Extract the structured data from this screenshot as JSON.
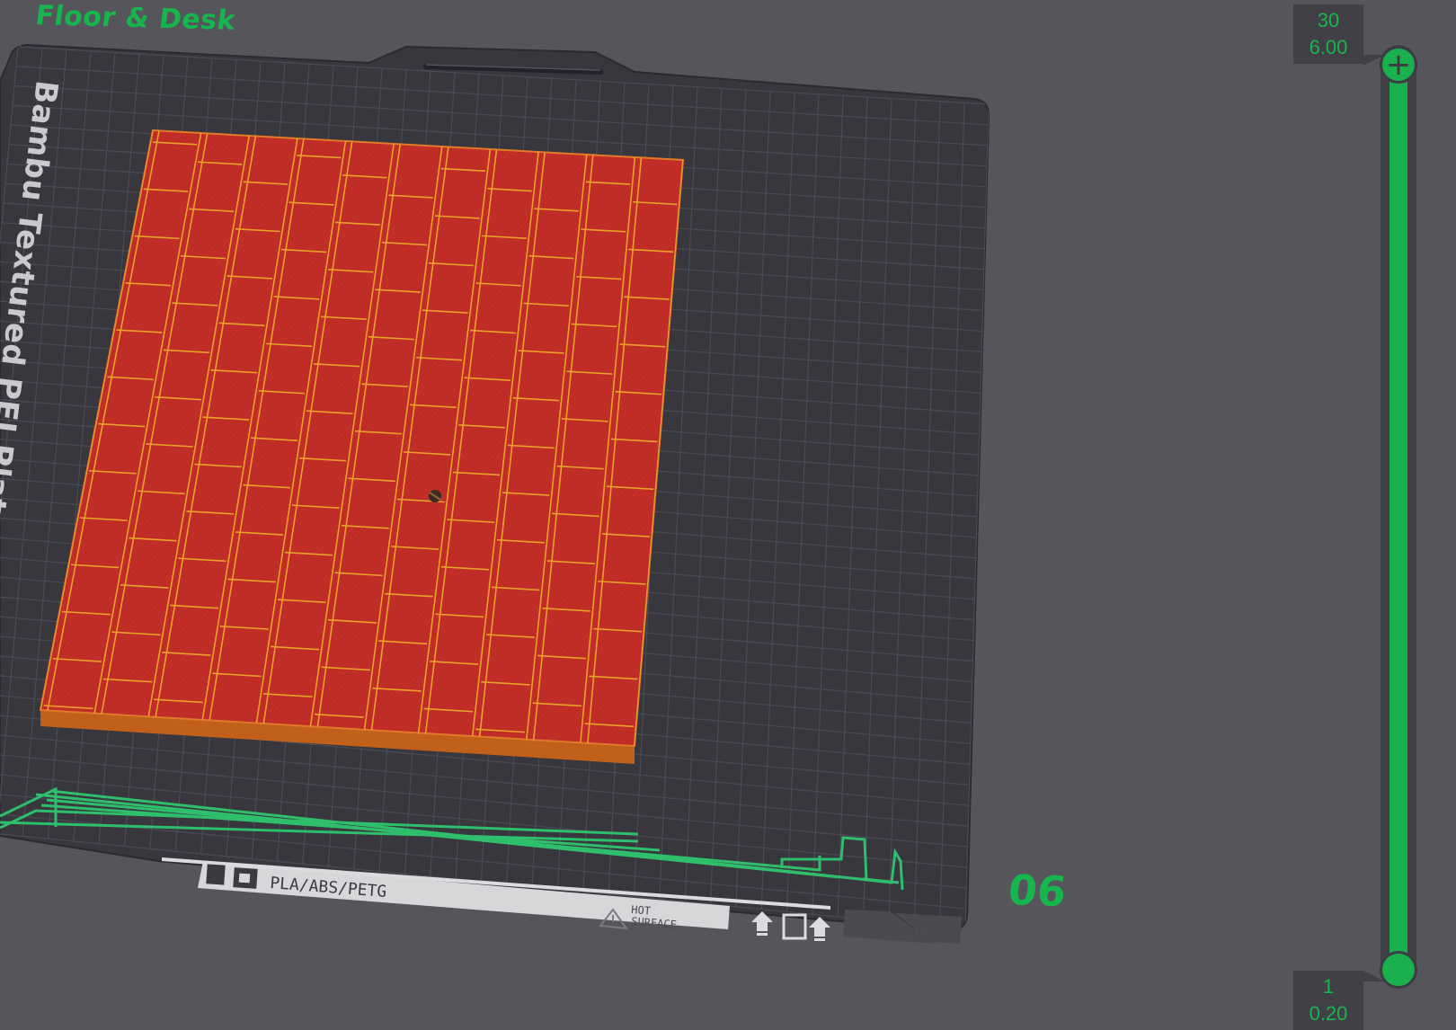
{
  "plate": {
    "name": "Floor & Desk",
    "number": "06",
    "bed_label": "Bambu Textured PEI Plat",
    "bed_material_text": "PLA/ABS/PETG",
    "hot_surface_line1": "HOT",
    "hot_surface_line2": "SURFACE"
  },
  "layer_slider": {
    "top_layer": "30",
    "top_height": "6.00",
    "bottom_layer": "1",
    "bottom_height": "0.20",
    "plus_symbol": "+"
  },
  "colors": {
    "background": "#55555b",
    "bed": "#3a3a40",
    "grid": "#4a4a52",
    "accent_green": "#17b54d",
    "model_top": "#c8332a",
    "model_lines": "#e8a22c",
    "model_edge": "#c0601a"
  },
  "icons": {
    "plate_orientation": "bed-orientation-icon",
    "hot_warning": "warning-triangle-icon",
    "slider_add": "plus-icon"
  }
}
